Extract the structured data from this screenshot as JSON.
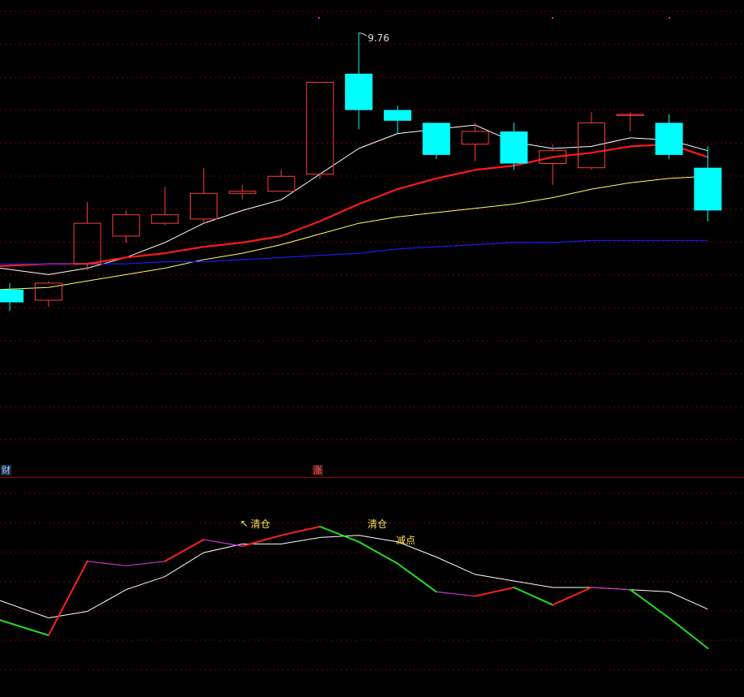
{
  "colors": {
    "background": "#000000",
    "grid": "#7a0000",
    "separator": "#a00000",
    "up_candle": "#ff3c3c",
    "down_candle": "#00ffff",
    "ma5": "#ffffff",
    "ma10": "#ff1a1a",
    "ma20": "#ffff66",
    "ma60": "#1a1aff",
    "osc_up": "#ff2020",
    "osc_mid": "#cc33cc",
    "osc_down": "#22dd22",
    "osc_signal": "#ffffff",
    "annotation": "#ffe14d"
  },
  "badges": [
    {
      "text": "财",
      "color": "#9ecfff",
      "bg": "#1a2a44"
    },
    {
      "text": "涨",
      "color": "#ff6a6a",
      "bg": "#4a1414"
    }
  ],
  "annotations": [
    {
      "text": "清仓",
      "arrow": "↖"
    },
    {
      "text": "清仓",
      "arrow": ""
    },
    {
      "text": "减点",
      "arrow": ""
    }
  ],
  "chart_data": [
    {
      "type": "candlestick",
      "title": "",
      "xlabel": "",
      "ylabel": "",
      "grid": true,
      "ylim": [
        8.1,
        9.82
      ],
      "max_label": "9.76",
      "candles": [
        {
          "open": 8.56,
          "close": 8.5,
          "high": 8.59,
          "low": 8.46
        },
        {
          "open": 8.51,
          "close": 8.59,
          "high": 8.6,
          "low": 8.48
        },
        {
          "open": 8.68,
          "close": 8.87,
          "high": 8.97,
          "low": 8.65
        },
        {
          "open": 8.81,
          "close": 8.91,
          "high": 8.93,
          "low": 8.78
        },
        {
          "open": 8.87,
          "close": 8.91,
          "high": 9.04,
          "low": 8.86
        },
        {
          "open": 8.89,
          "close": 9.01,
          "high": 9.13,
          "low": 8.87
        },
        {
          "open": 9.01,
          "close": 9.02,
          "high": 9.05,
          "low": 8.98
        },
        {
          "open": 9.02,
          "close": 9.09,
          "high": 9.12,
          "low": 9.02
        },
        {
          "open": 9.1,
          "close": 9.53,
          "high": 9.53,
          "low": 9.08
        },
        {
          "open": 9.57,
          "close": 9.4,
          "high": 9.76,
          "low": 9.31
        },
        {
          "open": 9.4,
          "close": 9.35,
          "high": 9.42,
          "low": 9.29
        },
        {
          "open": 9.34,
          "close": 9.19,
          "high": 9.34,
          "low": 9.17
        },
        {
          "open": 9.24,
          "close": 9.3,
          "high": 9.34,
          "low": 9.16
        },
        {
          "open": 9.3,
          "close": 9.15,
          "high": 9.34,
          "low": 9.12
        },
        {
          "open": 9.15,
          "close": 9.21,
          "high": 9.24,
          "low": 9.05
        },
        {
          "open": 9.13,
          "close": 9.34,
          "high": 9.39,
          "low": 9.12
        },
        {
          "open": 9.38,
          "close": 9.38,
          "high": 9.39,
          "low": 9.3
        },
        {
          "open": 9.34,
          "close": 9.19,
          "high": 9.38,
          "low": 9.17
        },
        {
          "open": 9.13,
          "close": 8.93,
          "high": 9.23,
          "low": 8.88
        }
      ],
      "series": [
        {
          "values": [
            8.66,
            8.63,
            8.66,
            8.71,
            8.78,
            8.87,
            8.93,
            8.98,
            9.1,
            9.22,
            9.29,
            9.31,
            9.33,
            9.25,
            9.22,
            9.23,
            9.27,
            9.26,
            9.21
          ]
        },
        {
          "values": [
            8.67,
            8.68,
            8.68,
            8.71,
            8.73,
            8.76,
            8.78,
            8.81,
            8.88,
            8.96,
            9.03,
            9.08,
            9.12,
            9.14,
            9.18,
            9.2,
            9.23,
            9.24,
            9.18
          ]
        },
        {
          "values": [
            8.56,
            8.57,
            8.6,
            8.63,
            8.66,
            8.7,
            8.73,
            8.77,
            8.82,
            8.87,
            8.9,
            8.92,
            8.94,
            8.96,
            8.99,
            9.03,
            9.06,
            9.08,
            9.09
          ]
        },
        {
          "values": [
            8.68,
            8.68,
            8.68,
            8.68,
            8.69,
            8.69,
            8.7,
            8.71,
            8.72,
            8.73,
            8.75,
            8.76,
            8.77,
            8.78,
            8.78,
            8.79,
            8.79,
            8.79,
            8.79
          ]
        }
      ]
    },
    {
      "type": "line",
      "title": "",
      "xlabel": "",
      "ylabel": "",
      "grid": true,
      "ylim": [
        0,
        100
      ],
      "series": [
        {
          "values": [
            35,
            28,
            62,
            60,
            62,
            72,
            69,
            74,
            78,
            71,
            61,
            48,
            46,
            50,
            42,
            50,
            49,
            36,
            22
          ]
        },
        {
          "values": [
            44,
            36,
            39,
            49,
            55,
            66,
            70,
            70,
            73,
            74,
            71,
            64,
            56,
            53,
            50,
            50,
            49,
            48,
            40
          ]
        }
      ]
    }
  ]
}
